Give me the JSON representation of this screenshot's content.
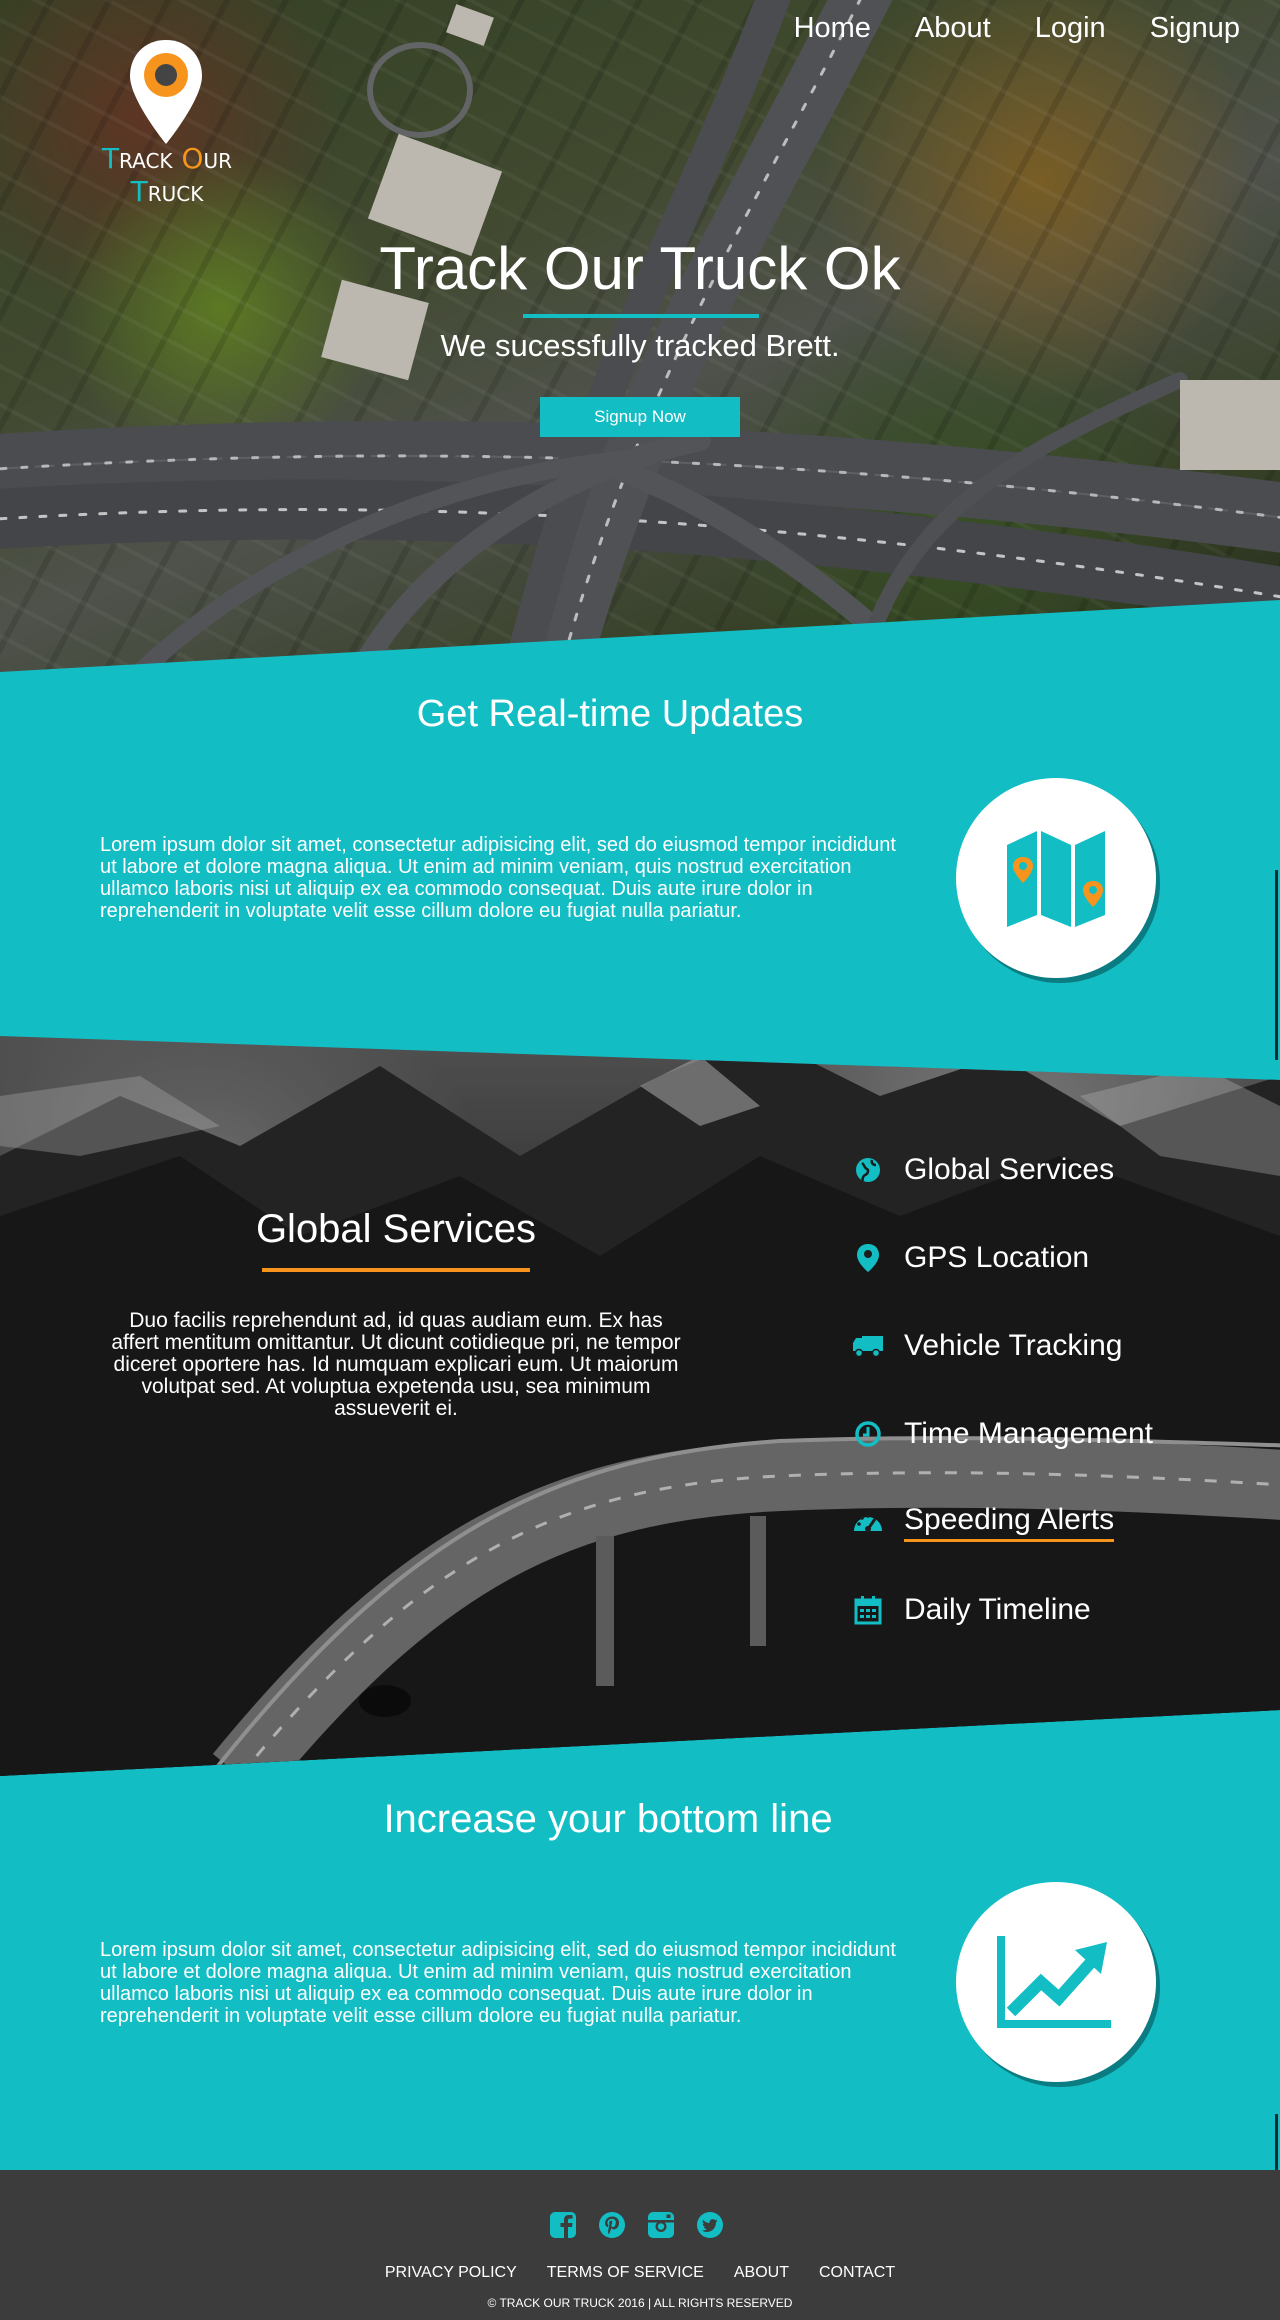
{
  "brand": {
    "logo_parts": [
      {
        "initial": "T",
        "rest": "rack "
      },
      {
        "initial": "O",
        "rest": "ur "
      },
      {
        "initial": "T",
        "rest": "ruck"
      }
    ],
    "colors": {
      "teal": "#13bdc4",
      "orange": "#f7941d",
      "footer": "#3c3c3c"
    }
  },
  "nav": {
    "items": [
      "Home",
      "About",
      "Login",
      "Signup"
    ]
  },
  "hero": {
    "title": "Track Our Truck Ok",
    "subtitle": "We sucessfully tracked Brett.",
    "cta_label": "Signup Now"
  },
  "updates": {
    "title": "Get Real-time Updates",
    "body": "Lorem ipsum dolor sit amet, consectetur adipisicing elit, sed do eiusmod tempor incididunt ut labore et dolore magna aliqua. Ut enim ad minim veniam, quis nostrud exercitation ullamco laboris nisi ut aliquip ex ea commodo consequat. Duis aute irure dolor in reprehenderit in voluptate velit esse cillum dolore eu fugiat nulla pariatur.",
    "icon": "map-icon"
  },
  "global": {
    "title": "Global Services",
    "body": "Duo facilis reprehendunt ad, id quas audiam eum. Ex has affert mentitum omittantur. Ut dicunt cotidieque pri, ne tempor diceret oportere has. Id numquam explicari eum. Ut maiorum volutpat sed. At voluptua expetenda usu, sea minimum assueverit ei.",
    "features": [
      {
        "label": "Global Services",
        "icon": "globe-icon"
      },
      {
        "label": "GPS Location",
        "icon": "map-marker-icon"
      },
      {
        "label": "Vehicle Tracking",
        "icon": "truck-icon"
      },
      {
        "label": "Time Management",
        "icon": "clock-icon"
      },
      {
        "label": "Speeding Alerts",
        "icon": "speedometer-icon",
        "active": true
      },
      {
        "label": "Daily Timeline",
        "icon": "calendar-icon"
      }
    ]
  },
  "bottom_line": {
    "title": "Increase your bottom line",
    "body": "Lorem ipsum dolor sit amet, consectetur adipisicing elit, sed do eiusmod tempor incididunt ut labore et dolore magna aliqua. Ut enim ad minim veniam, quis nostrud exercitation ullamco laboris nisi ut aliquip ex ea commodo consequat. Duis aute irure dolor in reprehenderit in voluptate velit esse cillum dolore eu fugiat nulla pariatur.",
    "icon": "trending-up-chart-icon"
  },
  "footer": {
    "socials": [
      "facebook-icon",
      "pinterest-icon",
      "instagram-icon",
      "twitter-icon"
    ],
    "links": [
      "PRIVACY POLICY",
      "TERMS OF SERVICE",
      "ABOUT",
      "CONTACT"
    ],
    "copyright": "© TRACK OUR TRUCK 2016 | ALL RIGHTS RESERVED"
  }
}
